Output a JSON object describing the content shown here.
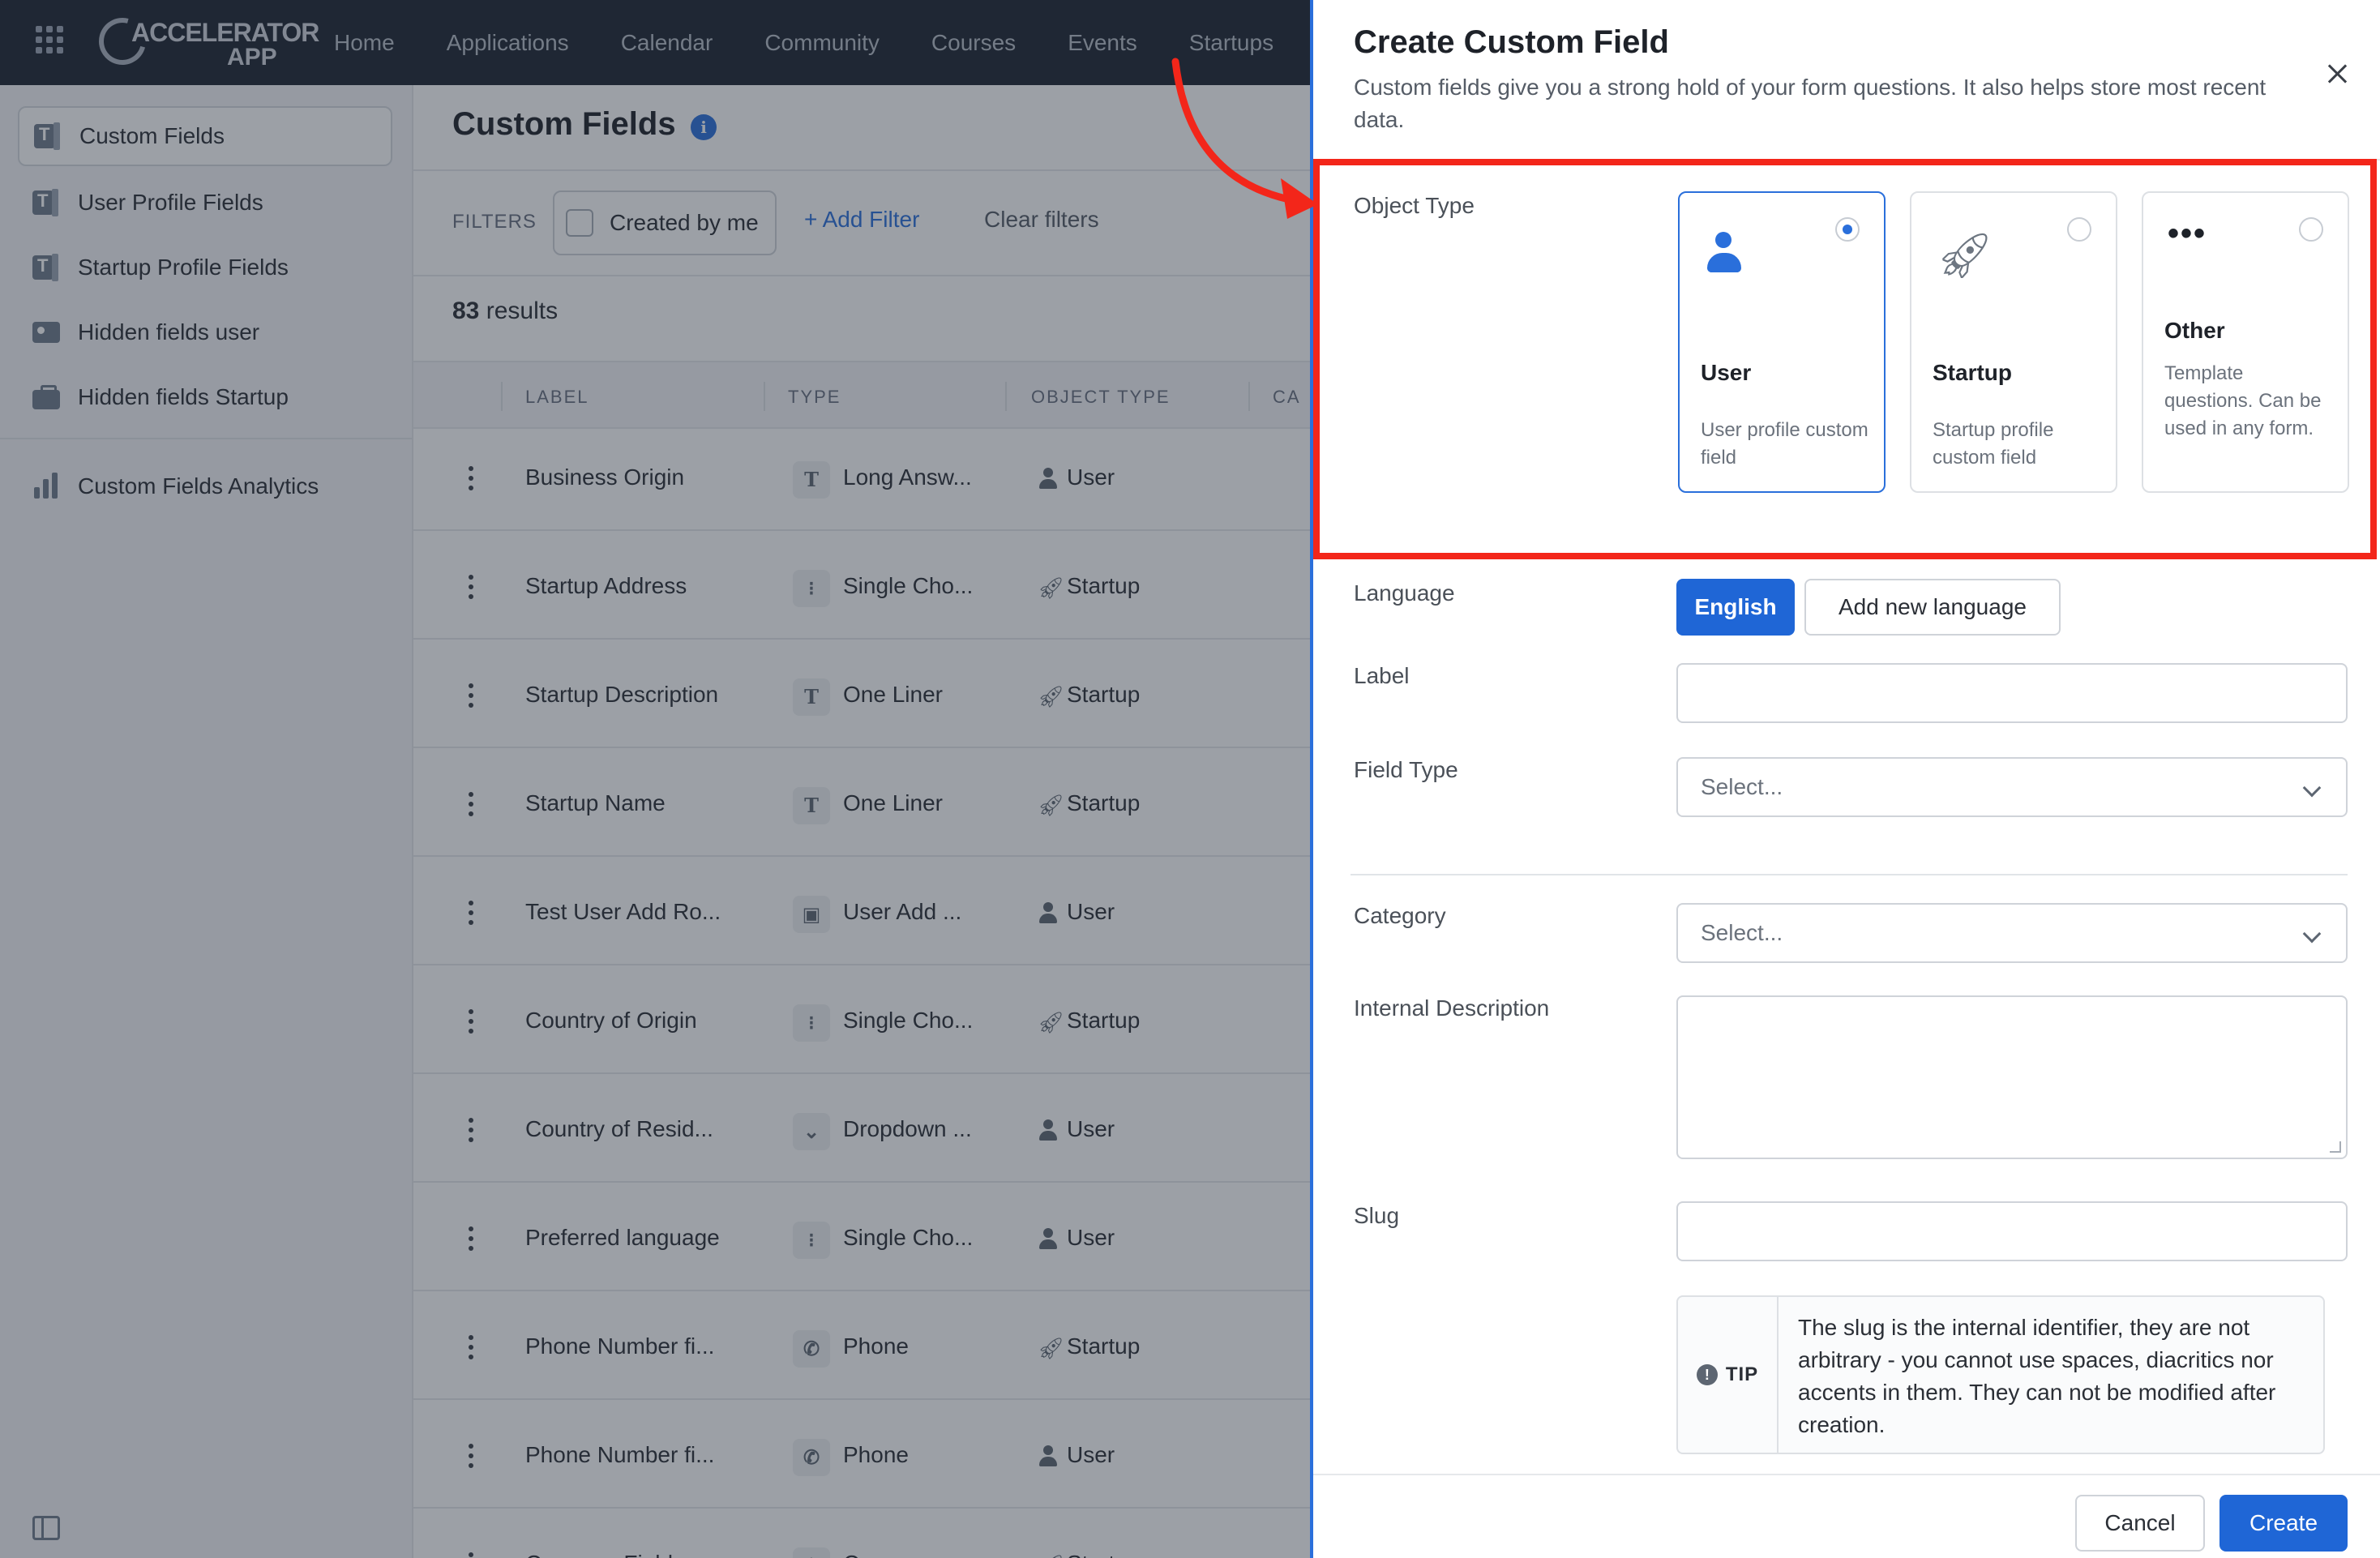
{
  "nav": {
    "logo_line1": "ACCELERATOR",
    "logo_line2": "APP",
    "links": [
      "Home",
      "Applications",
      "Calendar",
      "Community",
      "Courses",
      "Events",
      "Startups"
    ]
  },
  "sidebar": {
    "items": [
      {
        "label": "Custom Fields",
        "icon": "custom-fields-icon",
        "active": true
      },
      {
        "label": "User Profile Fields",
        "icon": "custom-fields-icon"
      },
      {
        "label": "Startup Profile Fields",
        "icon": "custom-fields-icon"
      },
      {
        "label": "Hidden fields user",
        "icon": "id-card-icon"
      },
      {
        "label": "Hidden fields Startup",
        "icon": "briefcase-icon"
      }
    ],
    "analytics": {
      "label": "Custom Fields Analytics",
      "icon": "bar-chart-icon"
    }
  },
  "main": {
    "title": "Custom Fields",
    "info_icon": "i",
    "filters_label": "FILTERS",
    "created_by_me": "Created by me",
    "add_filter": "+ Add Filter",
    "clear_filters": "Clear filters",
    "results_count": "83",
    "results_word": "results",
    "columns": [
      "LABEL",
      "TYPE",
      "OBJECT TYPE",
      "CA"
    ],
    "rows": [
      {
        "label": "Business Origin",
        "type_icon": "T",
        "type": "Long Answ...",
        "object": "User"
      },
      {
        "label": "Startup Address",
        "type_icon": "⁝",
        "type": "Single Cho...",
        "object": "Startup"
      },
      {
        "label": "Startup Description",
        "type_icon": "T",
        "type": "One Liner",
        "object": "Startup"
      },
      {
        "label": "Startup Name",
        "type_icon": "T",
        "type": "One Liner",
        "object": "Startup"
      },
      {
        "label": "Test User Add Ro...",
        "type_icon": "▣",
        "type": "User Add ...",
        "object": "User"
      },
      {
        "label": "Country of Origin",
        "type_icon": "⁝",
        "type": "Single Cho...",
        "object": "Startup"
      },
      {
        "label": "Country of Resid...",
        "type_icon": "⌄",
        "type": "Dropdown ...",
        "object": "User"
      },
      {
        "label": "Preferred language",
        "type_icon": "⁝",
        "type": "Single Cho...",
        "object": "User"
      },
      {
        "label": "Phone Number fi...",
        "type_icon": "✆",
        "type": "Phone",
        "object": "Startup"
      },
      {
        "label": "Phone Number fi...",
        "type_icon": "✆",
        "type": "Phone",
        "object": "User"
      },
      {
        "label": "Currency Field",
        "type_icon": "$",
        "type": "Currency",
        "object": "Startup"
      }
    ]
  },
  "dialog": {
    "title": "Create Custom Field",
    "subtitle": "Custom fields give you a strong hold of your form questions. It also helps store most recent data.",
    "object_type_label": "Object Type",
    "object_types": [
      {
        "title": "User",
        "desc": "User profile custom field",
        "selected": true,
        "icon": "user-icon"
      },
      {
        "title": "Startup",
        "desc": "Startup profile custom field",
        "selected": false,
        "icon": "rocket-icon"
      },
      {
        "title": "Other",
        "desc": "Template questions. Can be used in any form.",
        "selected": false,
        "icon": "dots-icon"
      }
    ],
    "language_label": "Language",
    "language_active": "English",
    "add_language": "Add new language",
    "label_label": "Label",
    "label_value": "",
    "field_type_label": "Field Type",
    "field_type_placeholder": "Select...",
    "category_label": "Category",
    "category_placeholder": "Select...",
    "internal_description_label": "Internal Description",
    "slug_label": "Slug",
    "slug_value": "",
    "tip_label": "TIP",
    "tip_text": "The slug is the internal identifier, they are not arbitrary - you cannot use spaces, diacritics nor accents in them. They can not be modified after creation.",
    "cancel": "Cancel",
    "create": "Create"
  },
  "colors": {
    "accent": "#1f66d6",
    "highlight": "#f3261a",
    "nav_bg": "#1c2430"
  }
}
